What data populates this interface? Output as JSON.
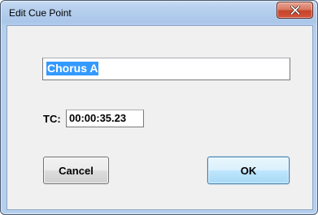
{
  "window": {
    "title": "Edit Cue Point",
    "close_icon": "close-icon"
  },
  "form": {
    "name_value": "Chorus A",
    "tc_label": "TC:",
    "tc_value": "00:00:35.23"
  },
  "buttons": {
    "cancel_label": "Cancel",
    "ok_label": "OK"
  },
  "colors": {
    "selection": "#3399ff",
    "close_button": "#c7442a",
    "titlebar": "#b9d1ee"
  }
}
